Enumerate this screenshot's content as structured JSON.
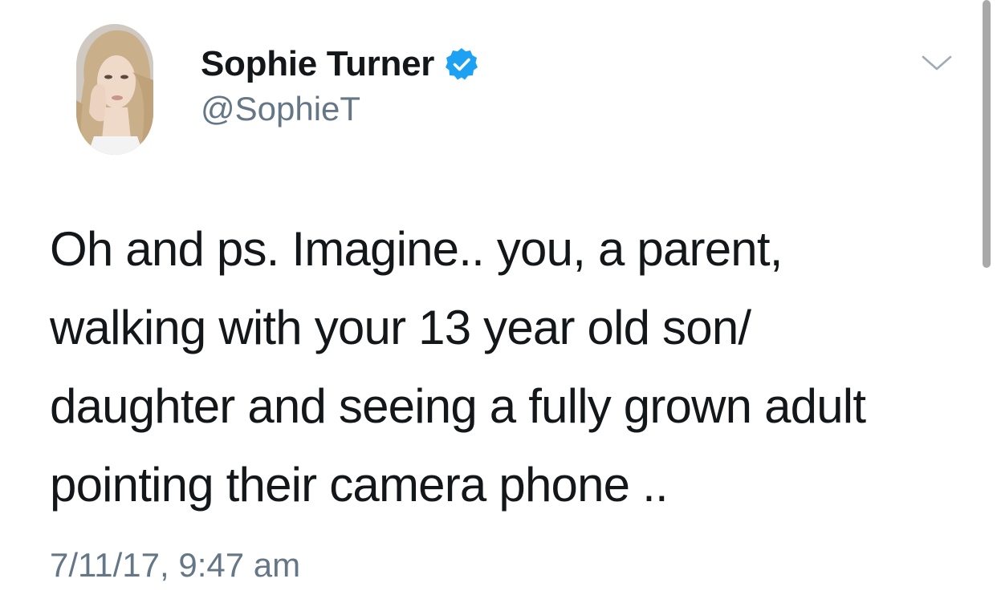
{
  "user": {
    "display_name": "Sophie Turner",
    "handle": "@SophieT",
    "verified": true
  },
  "tweet": {
    "lines": [
      "Oh and ps. Imagine.. you, a parent,",
      "walking with your 13 year old son/",
      "daughter and seeing a fully grown adult",
      "pointing their camera phone .."
    ],
    "timestamp": "7/11/17, 9:47 am"
  },
  "icons": {
    "verified": "verified-badge-icon",
    "menu": "chevron-down-icon"
  },
  "colors": {
    "text": "#14171a",
    "secondary": "#657786",
    "verified_blue": "#1da1f2",
    "scrollbar": "#a9a9a9"
  }
}
